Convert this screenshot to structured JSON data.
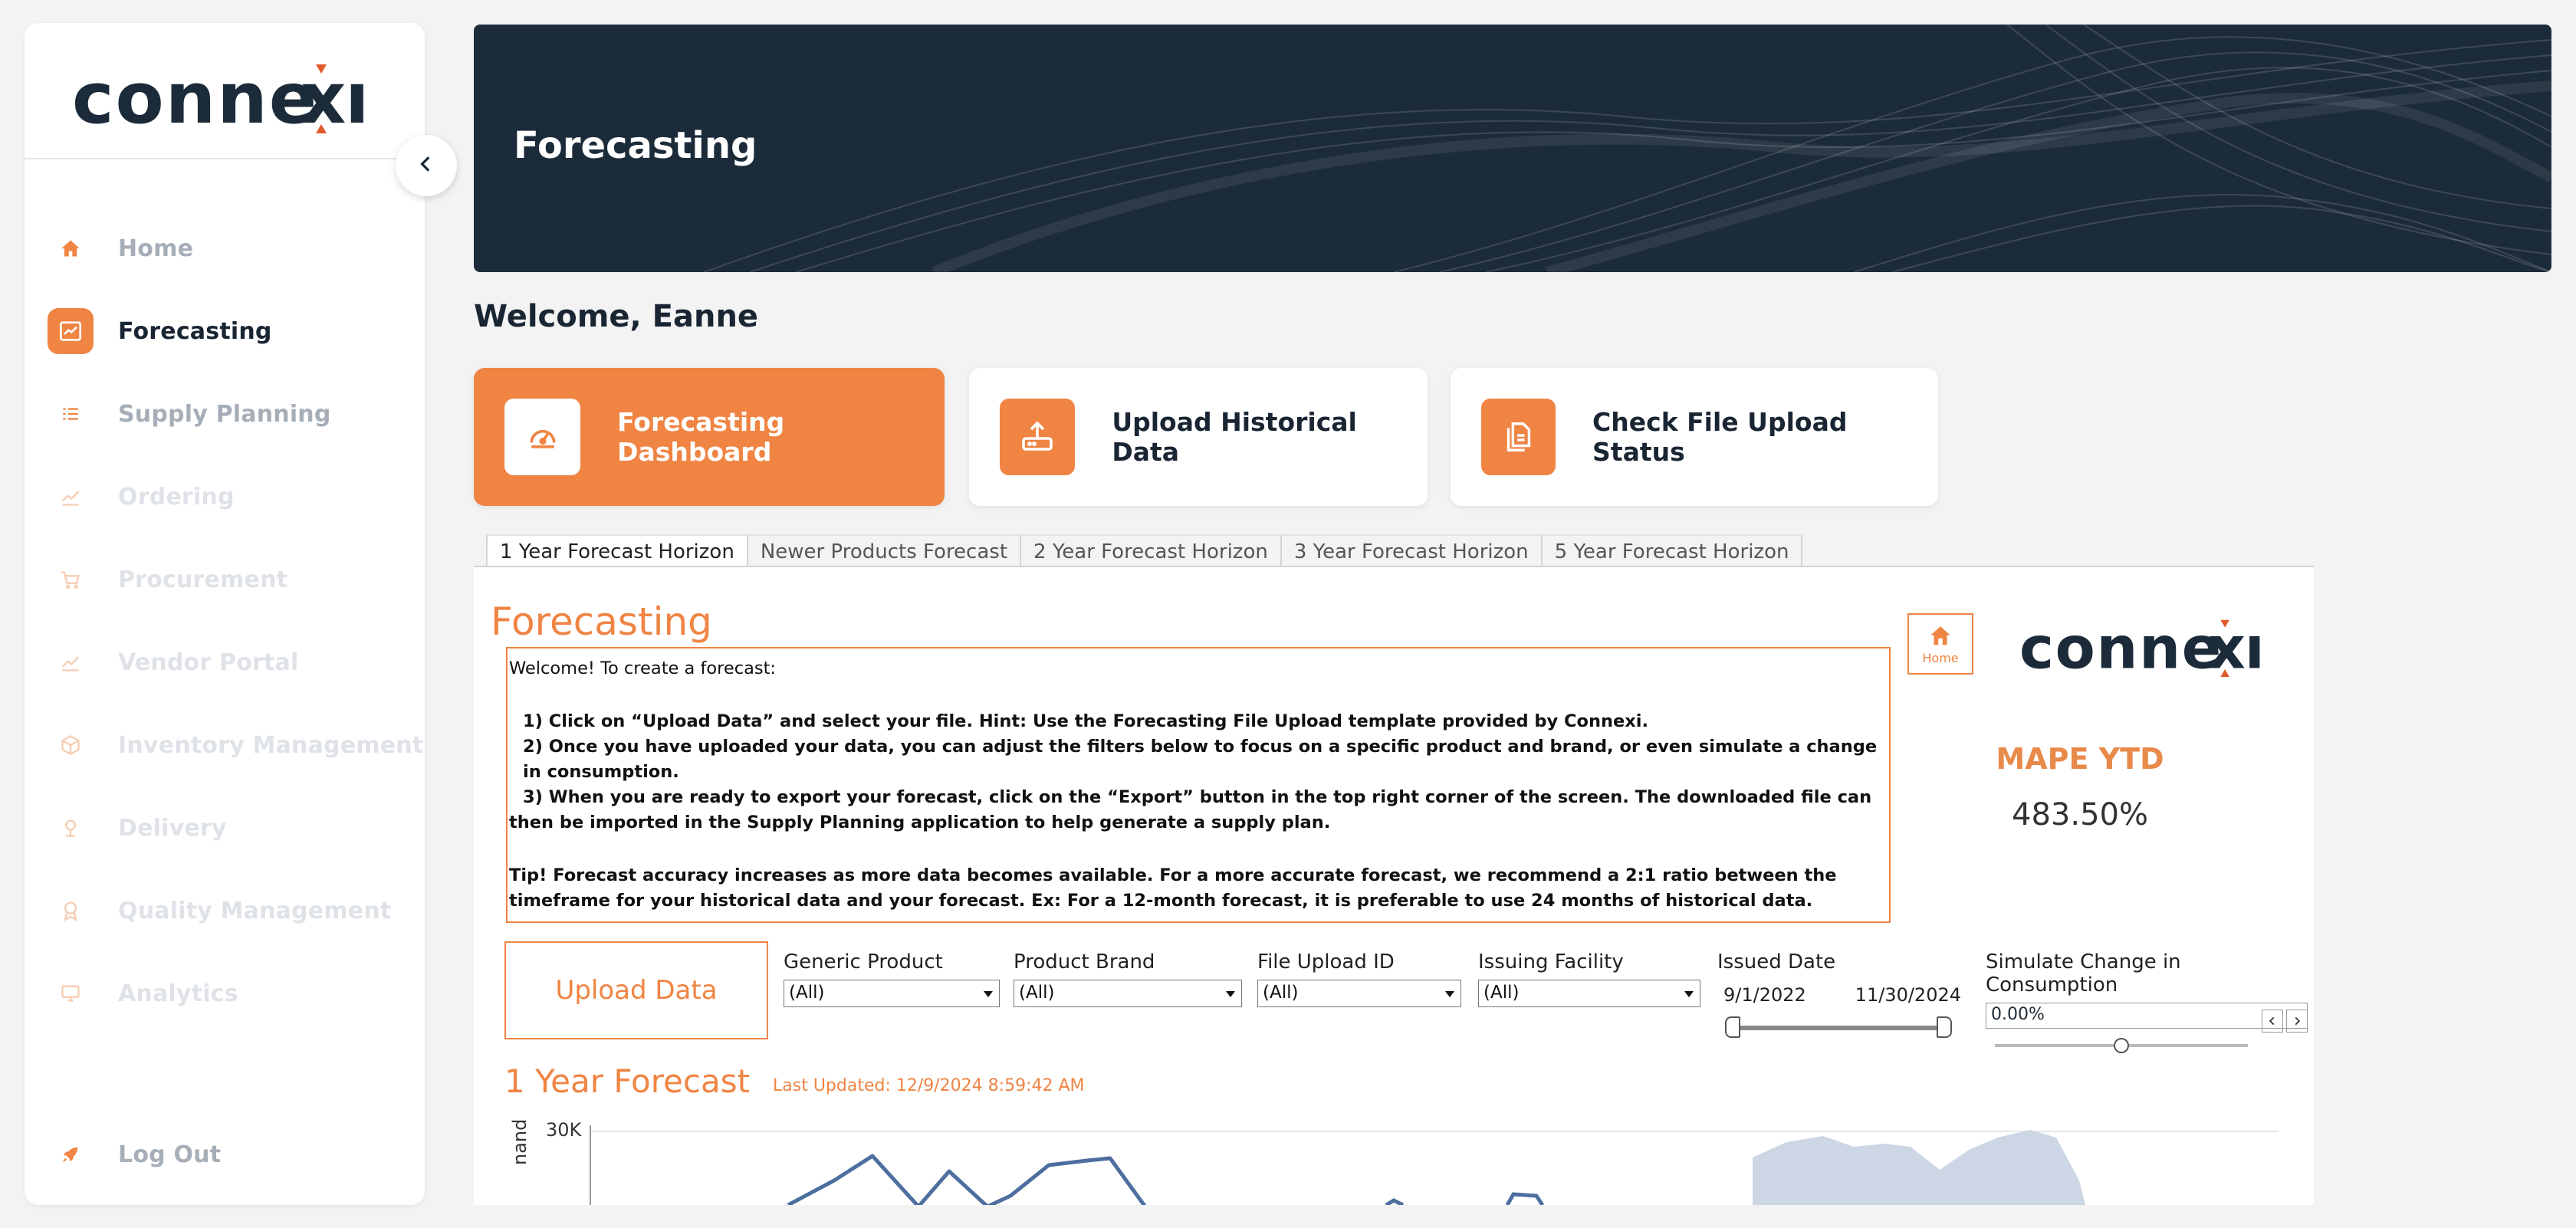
{
  "brand": {
    "name": "connexi",
    "accent": "#ef8443",
    "navy": "#1c2b3a"
  },
  "sidebar": {
    "items": [
      {
        "label": "Home",
        "icon": "home-icon",
        "state": "enabled"
      },
      {
        "label": "Forecasting",
        "icon": "trend-chart-icon",
        "state": "active"
      },
      {
        "label": "Supply Planning",
        "icon": "list-icon",
        "state": "enabled"
      },
      {
        "label": "Ordering",
        "icon": "trend-icon",
        "state": "disabled"
      },
      {
        "label": "Procurement",
        "icon": "cart-icon",
        "state": "disabled"
      },
      {
        "label": "Vendor Portal",
        "icon": "trend-icon",
        "state": "disabled"
      },
      {
        "label": "Inventory Management",
        "icon": "box-icon",
        "state": "disabled"
      },
      {
        "label": "Delivery",
        "icon": "pin-icon",
        "state": "disabled"
      },
      {
        "label": "Quality Management",
        "icon": "badge-icon",
        "state": "disabled"
      },
      {
        "label": "Analytics",
        "icon": "monitor-icon",
        "state": "disabled"
      }
    ],
    "logout": "Log Out"
  },
  "banner": {
    "title": "Forecasting"
  },
  "welcome": "Welcome, Eanne",
  "cards": [
    {
      "label": "Forecasting Dashboard",
      "icon": "gauge-icon",
      "active": true
    },
    {
      "label": "Upload Historical Data",
      "icon": "upload-icon",
      "active": false
    },
    {
      "label": "Check File Upload Status",
      "icon": "files-icon",
      "active": false
    }
  ],
  "tabs": [
    "1 Year Forecast Horizon",
    "Newer Products Forecast",
    "2 Year Forecast Horizon",
    "3 Year Forecast Horizon",
    "5 Year Forecast Horizon"
  ],
  "panel": {
    "title": "Forecasting",
    "instructions": {
      "intro": "Welcome! To create a forecast:",
      "step1": "1) Click on “Upload Data” and select your file. Hint: Use the Forecasting File Upload template provided by Connexi.",
      "step2": "2) Once you have uploaded your data, you can adjust the filters below to focus on a specific product and brand, or even simulate a change in consumption.",
      "step3": "3) When you are ready to export your forecast, click on the “Export” button in the top right corner of the screen. The downloaded file can then be imported in the Supply Planning application to help generate a supply plan.",
      "tip": "Tip! Forecast accuracy increases as more data becomes available. For a more accurate forecast, we recommend a 2:1 ratio between the timeframe for your historical data and your forecast. Ex: For a 12-month forecast, it is preferable to use 24 months of historical data."
    },
    "home_button": "Home",
    "mape_label": "MAPE YTD",
    "mape_value": "483.50%",
    "upload_button": "Upload Data",
    "filters": {
      "generic_product": {
        "label": "Generic Product",
        "value": "(All)"
      },
      "product_brand": {
        "label": "Product Brand",
        "value": "(All)"
      },
      "file_upload_id": {
        "label": "File Upload ID",
        "value": "(All)"
      },
      "issuing_facility": {
        "label": "Issuing Facility",
        "value": "(All)"
      },
      "issued_date": {
        "label": "Issued Date",
        "start": "9/1/2022",
        "end": "11/30/2024"
      },
      "simulate": {
        "label": "Simulate Change in Consumption",
        "value": "0.00%",
        "slider_level": 0.5
      }
    },
    "forecast": {
      "title": "1 Year Forecast",
      "last_updated": "Last Updated: 12/9/2024 8:59:42 AM",
      "y_tick_top": "30K",
      "y_axis_partial": "nand"
    }
  }
}
